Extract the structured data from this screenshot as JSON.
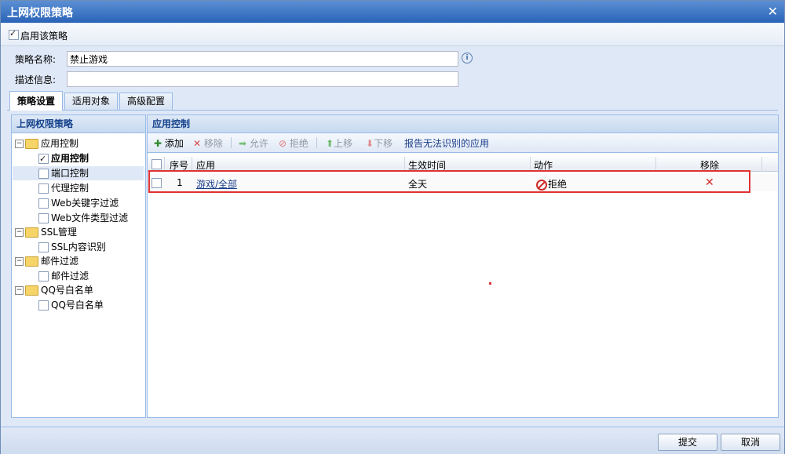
{
  "window": {
    "title": "上网权限策略",
    "close": "✕"
  },
  "enable": {
    "label": "启用该策略",
    "checked": true
  },
  "form": {
    "name_label": "策略名称:",
    "name_value": "禁止游戏",
    "desc_label": "描述信息:",
    "desc_value": ""
  },
  "tabs": [
    {
      "label": "策略设置"
    },
    {
      "label": "适用对象"
    },
    {
      "label": "高级配置"
    }
  ],
  "left_panel": {
    "title": "上网权限策略",
    "tree": [
      {
        "label": "应用控制"
      },
      {
        "label": "应用控制"
      },
      {
        "label": "端口控制"
      },
      {
        "label": "代理控制"
      },
      {
        "label": "Web关键字过滤"
      },
      {
        "label": "Web文件类型过滤"
      },
      {
        "label": "SSL管理"
      },
      {
        "label": "SSL内容识别"
      },
      {
        "label": "邮件过滤"
      },
      {
        "label": "邮件过滤"
      },
      {
        "label": "QQ号白名单"
      },
      {
        "label": "QQ号白名单"
      }
    ]
  },
  "right_panel": {
    "title": "应用控制",
    "toolbar": {
      "add": "添加",
      "remove": "移除",
      "allow": "允许",
      "deny": "拒绝",
      "up": "上移",
      "down": "下移",
      "report": "报告无法识别的应用"
    },
    "columns": [
      "序号",
      "应用",
      "生效时间",
      "动作",
      "移除"
    ],
    "rows": [
      {
        "index": "1",
        "app": "游戏/全部",
        "time": "全天",
        "action": "拒绝",
        "remove": "✕"
      }
    ]
  },
  "buttons": {
    "submit": "提交",
    "cancel": "取消"
  }
}
